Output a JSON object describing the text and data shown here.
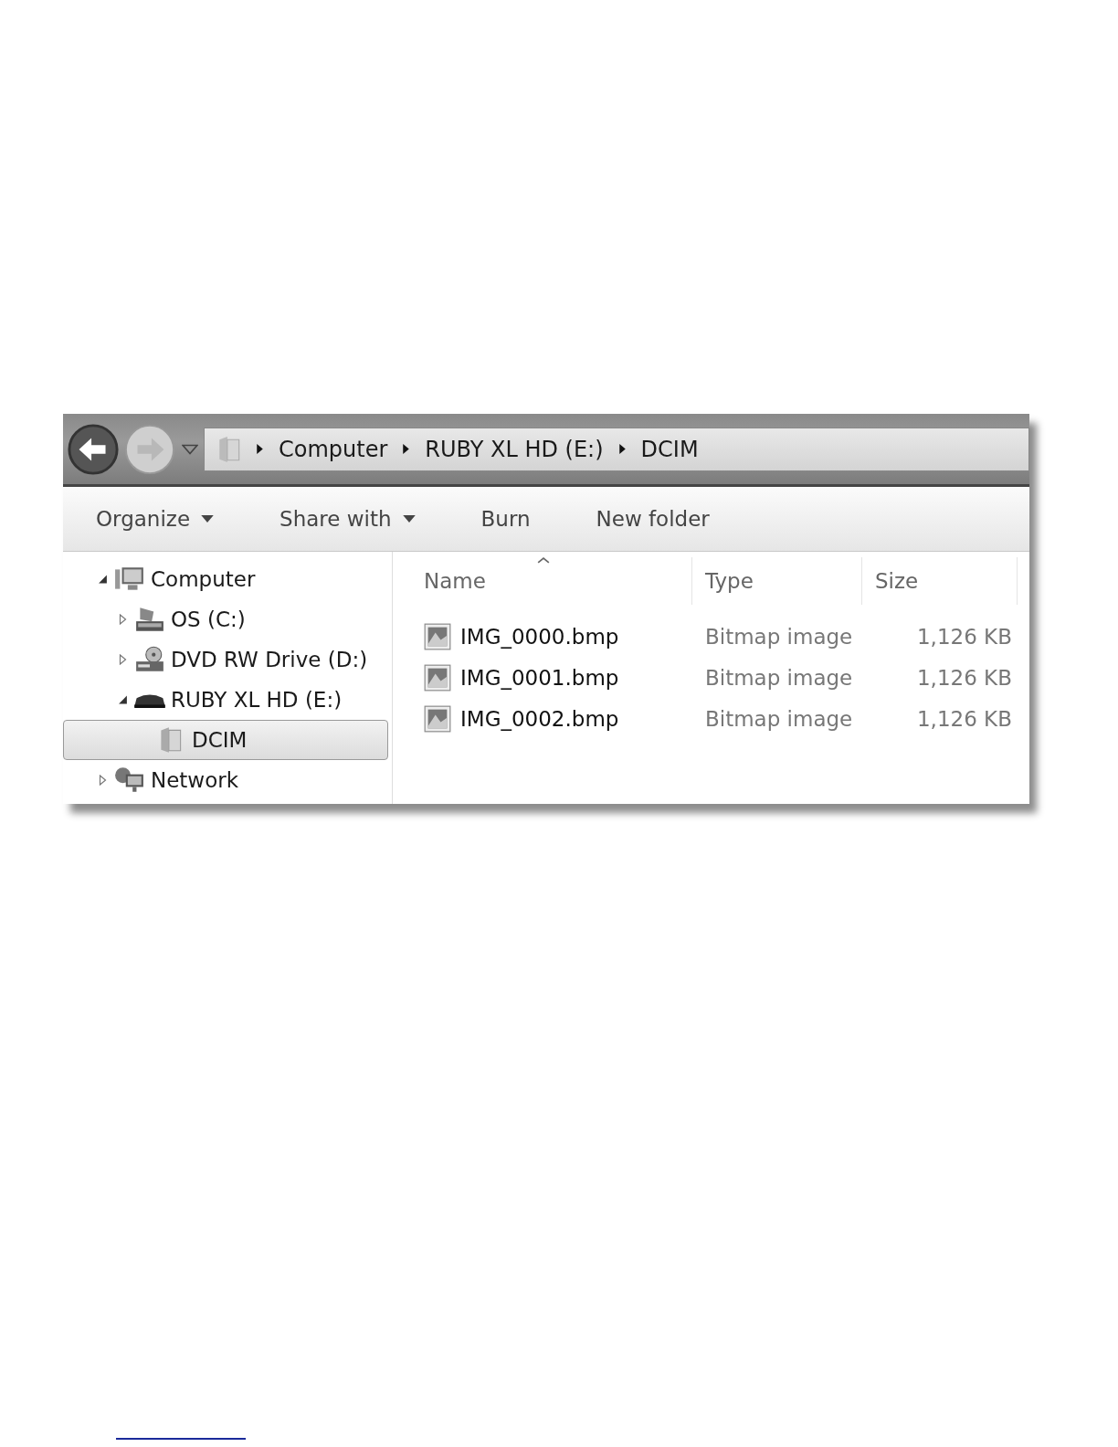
{
  "address_bar": {
    "breadcrumbs": [
      "Computer",
      "RUBY XL HD (E:)",
      "DCIM"
    ]
  },
  "toolbar": [
    {
      "label": "Organize",
      "dropdown": true
    },
    {
      "label": "Share with",
      "dropdown": true
    },
    {
      "label": "Burn",
      "dropdown": false
    },
    {
      "label": "New folder",
      "dropdown": false
    }
  ],
  "tree": [
    {
      "label": "Computer",
      "kind": "computer",
      "expanded": true,
      "selected": false,
      "children": [
        {
          "label": "OS (C:)",
          "kind": "drive",
          "expanded": false,
          "selected": false
        },
        {
          "label": "DVD RW Drive (D:)",
          "kind": "dvd",
          "expanded": false,
          "selected": false
        },
        {
          "label": "RUBY XL HD (E:)",
          "kind": "usb",
          "expanded": true,
          "selected": false,
          "children": [
            {
              "label": "DCIM",
              "kind": "folder",
              "selected": true
            }
          ]
        }
      ]
    },
    {
      "label": "Network",
      "kind": "network",
      "expanded": false,
      "selected": false
    }
  ],
  "columns": [
    "Name",
    "Type",
    "Size"
  ],
  "files": [
    {
      "name": "IMG_0000.bmp",
      "type": "Bitmap image",
      "size": "1,126 KB"
    },
    {
      "name": "IMG_0001.bmp",
      "type": "Bitmap image",
      "size": "1,126 KB"
    },
    {
      "name": "IMG_0002.bmp",
      "type": "Bitmap image",
      "size": "1,126 KB"
    }
  ]
}
